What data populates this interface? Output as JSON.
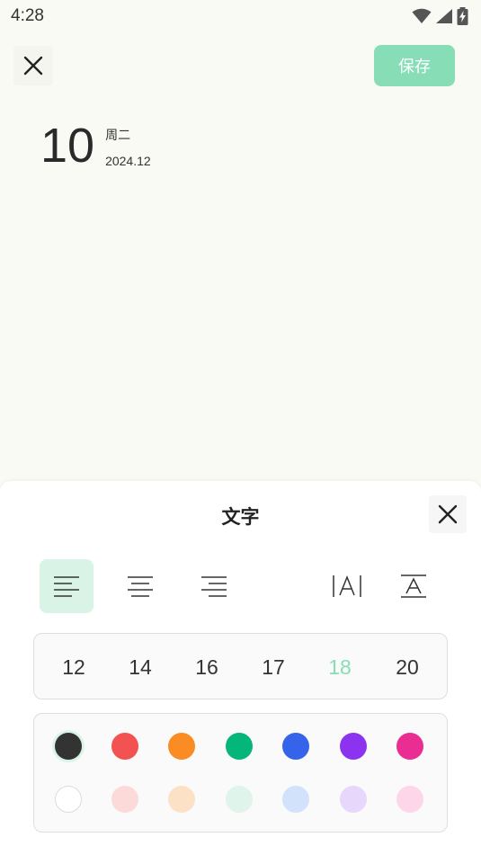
{
  "status_bar": {
    "time": "4:28"
  },
  "header": {
    "save_label": "保存"
  },
  "date": {
    "day": "10",
    "weekday": "周二",
    "year_month": "2024.12"
  },
  "panel": {
    "title": "文字",
    "font_sizes": [
      "12",
      "14",
      "16",
      "17",
      "18",
      "20"
    ],
    "selected_font_size": "18",
    "colors_row1": [
      "#333333",
      "#f25252",
      "#fa8c23",
      "#04b67a",
      "#3563e9",
      "#8b33ee",
      "#ea2d93"
    ],
    "colors_row2": [
      "#ffffff",
      "#fddada",
      "#fde1c6",
      "#dff4ea",
      "#d3e2fb",
      "#e6d7fb",
      "#fdd6ea"
    ],
    "selected_color": "#333333",
    "accent": "#86ddb6"
  }
}
